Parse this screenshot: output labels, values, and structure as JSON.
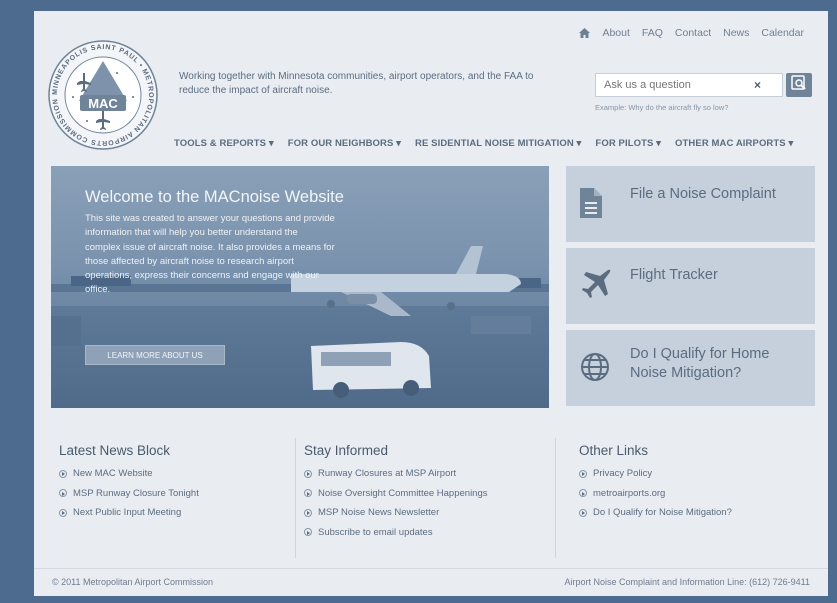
{
  "topnav": {
    "items": [
      "About",
      "FAQ",
      "Contact",
      "News",
      "Calendar"
    ]
  },
  "logo": {
    "abbr": "MAC",
    "ring_text": "MINNEAPOLIS SAINT PAUL METROPOLITAN AIRPORTS COMMISSION"
  },
  "header": {
    "tagline": "Working together with Minnesota communities, airport operators, and the FAA to reduce the impact of aircraft noise."
  },
  "search": {
    "placeholder": "Ask us a question",
    "clear_label": "×",
    "example": "Example: Why do the aircraft fly so low?",
    "icon": "search-icon"
  },
  "mainnav": {
    "items": [
      "TOOLS & REPORTS ▾",
      "FOR OUR NEIGHBORS ▾",
      "RE SIDENTIAL NOISE MITIGATION ▾",
      "FOR PILOTS ▾",
      "OTHER MAC AIRPORTS ▾"
    ]
  },
  "hero": {
    "title": "Welcome to the MACnoise Website",
    "text": "This site was created to answer your questions and provide information that will help you better understand the complex issue of aircraft noise. It also provides a means for those affected by aircraft noise to research airport operations, express their concerns and engage with our office.",
    "button": "LEARN MORE ABOUT US"
  },
  "cards": [
    {
      "label": "File a Noise Complaint",
      "icon": "document-icon"
    },
    {
      "label": "Flight Tracker",
      "icon": "airplane-icon"
    },
    {
      "label": "Do I Qualify for Home Noise Mitigation?",
      "icon": "globe-icon"
    }
  ],
  "columns": {
    "news": {
      "title": "Latest News Block",
      "items": [
        "New MAC Website",
        "MSP Runway Closure Tonight",
        "Next Public Input Meeting"
      ]
    },
    "informed": {
      "title": "Stay Informed",
      "items": [
        "Runway Closures at MSP Airport",
        "Noise Oversight Committee Happenings",
        "MSP Noise News Newsletter",
        "Subscribe to email updates"
      ]
    },
    "links": {
      "title": "Other Links",
      "items": [
        "Privacy Policy",
        "metroairports.org",
        "Do I Qualify for Noise Mitigation?"
      ]
    }
  },
  "footer": {
    "copyright": "© 2011 Metropolitan Airport Commission",
    "contact": "Airport Noise Complaint and Information Line: (612) 726-9411"
  },
  "colors": {
    "frame": "#4d6a8f",
    "page": "#e9edf2",
    "card": "#c5d0dc",
    "text": "#4a5a6c"
  }
}
